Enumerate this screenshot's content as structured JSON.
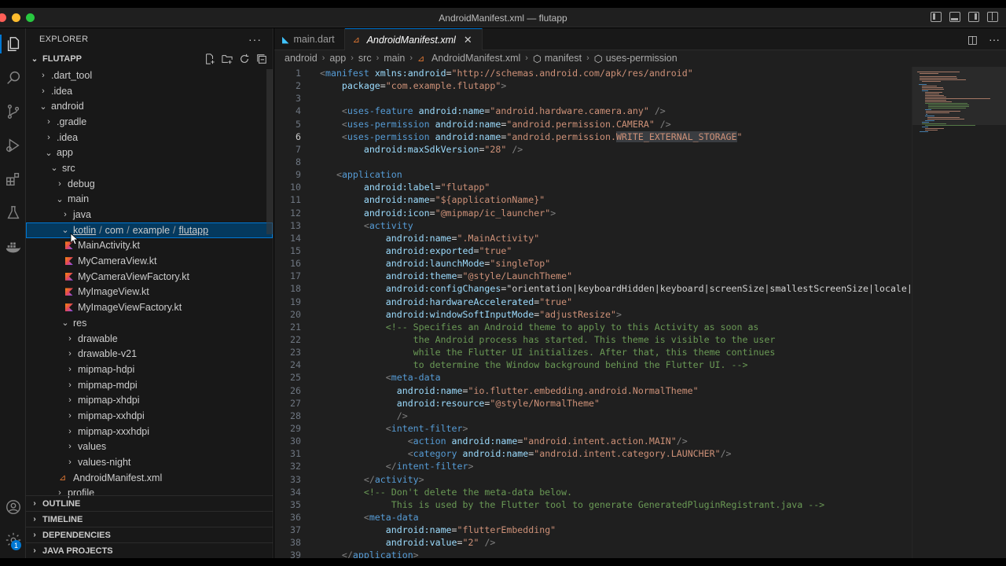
{
  "window": {
    "title": "AndroidManifest.xml — flutapp"
  },
  "activity_bar": {
    "items": [
      "explorer-icon",
      "search-icon",
      "source-control-icon",
      "run-debug-icon",
      "extensions-icon",
      "testing-icon",
      "docker-icon"
    ],
    "bottom": [
      "account-icon",
      "manage-gear-icon"
    ],
    "badge": "1"
  },
  "sidebar": {
    "header": "EXPLORER",
    "more": "···",
    "project": "FLUTAPP",
    "tree": [
      {
        "label": ".dart_tool",
        "twisty": "›"
      },
      {
        "label": ".idea",
        "twisty": "›"
      },
      {
        "label": "android",
        "twisty": "⌄"
      },
      {
        "label": ".gradle",
        "twisty": "›"
      },
      {
        "label": ".idea",
        "twisty": "›"
      },
      {
        "label": "app",
        "twisty": "⌄"
      },
      {
        "label": "src",
        "twisty": "⌄"
      },
      {
        "label": "debug",
        "twisty": "›"
      },
      {
        "label": "main",
        "twisty": "⌄"
      },
      {
        "label": "java",
        "twisty": "›"
      },
      {
        "label_parts": [
          "kotlin",
          "com",
          "example",
          "flutapp"
        ],
        "twisty": "⌄",
        "separator": "/"
      },
      {
        "label": "MainActivity.kt"
      },
      {
        "label": "MyCameraView.kt"
      },
      {
        "label": "MyCameraViewFactory.kt"
      },
      {
        "label": "MyImageView.kt"
      },
      {
        "label": "MyImageViewFactory.kt"
      },
      {
        "label": "res",
        "twisty": "⌄"
      },
      {
        "label": "drawable",
        "twisty": "›"
      },
      {
        "label": "drawable-v21",
        "twisty": "›"
      },
      {
        "label": "mipmap-hdpi",
        "twisty": "›"
      },
      {
        "label": "mipmap-mdpi",
        "twisty": "›"
      },
      {
        "label": "mipmap-xhdpi",
        "twisty": "›"
      },
      {
        "label": "mipmap-xxhdpi",
        "twisty": "›"
      },
      {
        "label": "mipmap-xxxhdpi",
        "twisty": "›"
      },
      {
        "label": "values",
        "twisty": "›"
      },
      {
        "label": "values-night",
        "twisty": "›"
      },
      {
        "label": "AndroidManifest.xml"
      },
      {
        "label": "profile",
        "twisty": "›"
      }
    ],
    "sections": [
      "OUTLINE",
      "TIMELINE",
      "DEPENDENCIES",
      "JAVA PROJECTS"
    ]
  },
  "editor": {
    "tabs": [
      {
        "label": "main.dart",
        "active": false
      },
      {
        "label": "AndroidManifest.xml",
        "active": true
      }
    ],
    "breadcrumbs": [
      "android",
      "app",
      "src",
      "main",
      "AndroidManifest.xml",
      "manifest",
      "uses-permission"
    ],
    "current_line": 6,
    "lines": [
      "<manifest xmlns:android=\"http://schemas.android.com/apk/res/android\"",
      "    package=\"com.example.flutapp\">",
      "",
      "    <uses-feature android:name=\"android.hardware.camera.any\" />",
      "    <uses-permission android:name=\"android.permission.CAMERA\" />",
      "    <uses-permission android:name=\"android.permission.WRITE_EXTERNAL_STORAGE\"",
      "        android:maxSdkVersion=\"28\" />",
      "",
      "   <application",
      "        android:label=\"flutapp\"",
      "        android:name=\"${applicationName}\"",
      "        android:icon=\"@mipmap/ic_launcher\">",
      "        <activity",
      "            android:name=\".MainActivity\"",
      "            android:exported=\"true\"",
      "            android:launchMode=\"singleTop\"",
      "            android:theme=\"@style/LaunchTheme\"",
      "            android:configChanges=\"orientation|keyboardHidden|keyboard|screenSize|smallestScreenSize|locale|layoutDi",
      "            android:hardwareAccelerated=\"true\"",
      "            android:windowSoftInputMode=\"adjustResize\">",
      "            <!-- Specifies an Android theme to apply to this Activity as soon as",
      "                 the Android process has started. This theme is visible to the user",
      "                 while the Flutter UI initializes. After that, this theme continues",
      "                 to determine the Window background behind the Flutter UI. -->",
      "            <meta-data",
      "              android:name=\"io.flutter.embedding.android.NormalTheme\"",
      "              android:resource=\"@style/NormalTheme\"",
      "              />",
      "            <intent-filter>",
      "                <action android:name=\"android.intent.action.MAIN\"/>",
      "                <category android:name=\"android.intent.category.LAUNCHER\"/>",
      "            </intent-filter>",
      "        </activity>",
      "        <!-- Don't delete the meta-data below.",
      "             This is used by the Flutter tool to generate GeneratedPluginRegistrant.java -->",
      "        <meta-data",
      "            android:name=\"flutterEmbedding\"",
      "            android:value=\"2\" />",
      "    </application>"
    ]
  },
  "colors": {
    "accent": "#0078d4",
    "tag": "#569cd6",
    "attribute": "#9cdcfe",
    "string": "#ce9178",
    "comment": "#6a9955"
  }
}
